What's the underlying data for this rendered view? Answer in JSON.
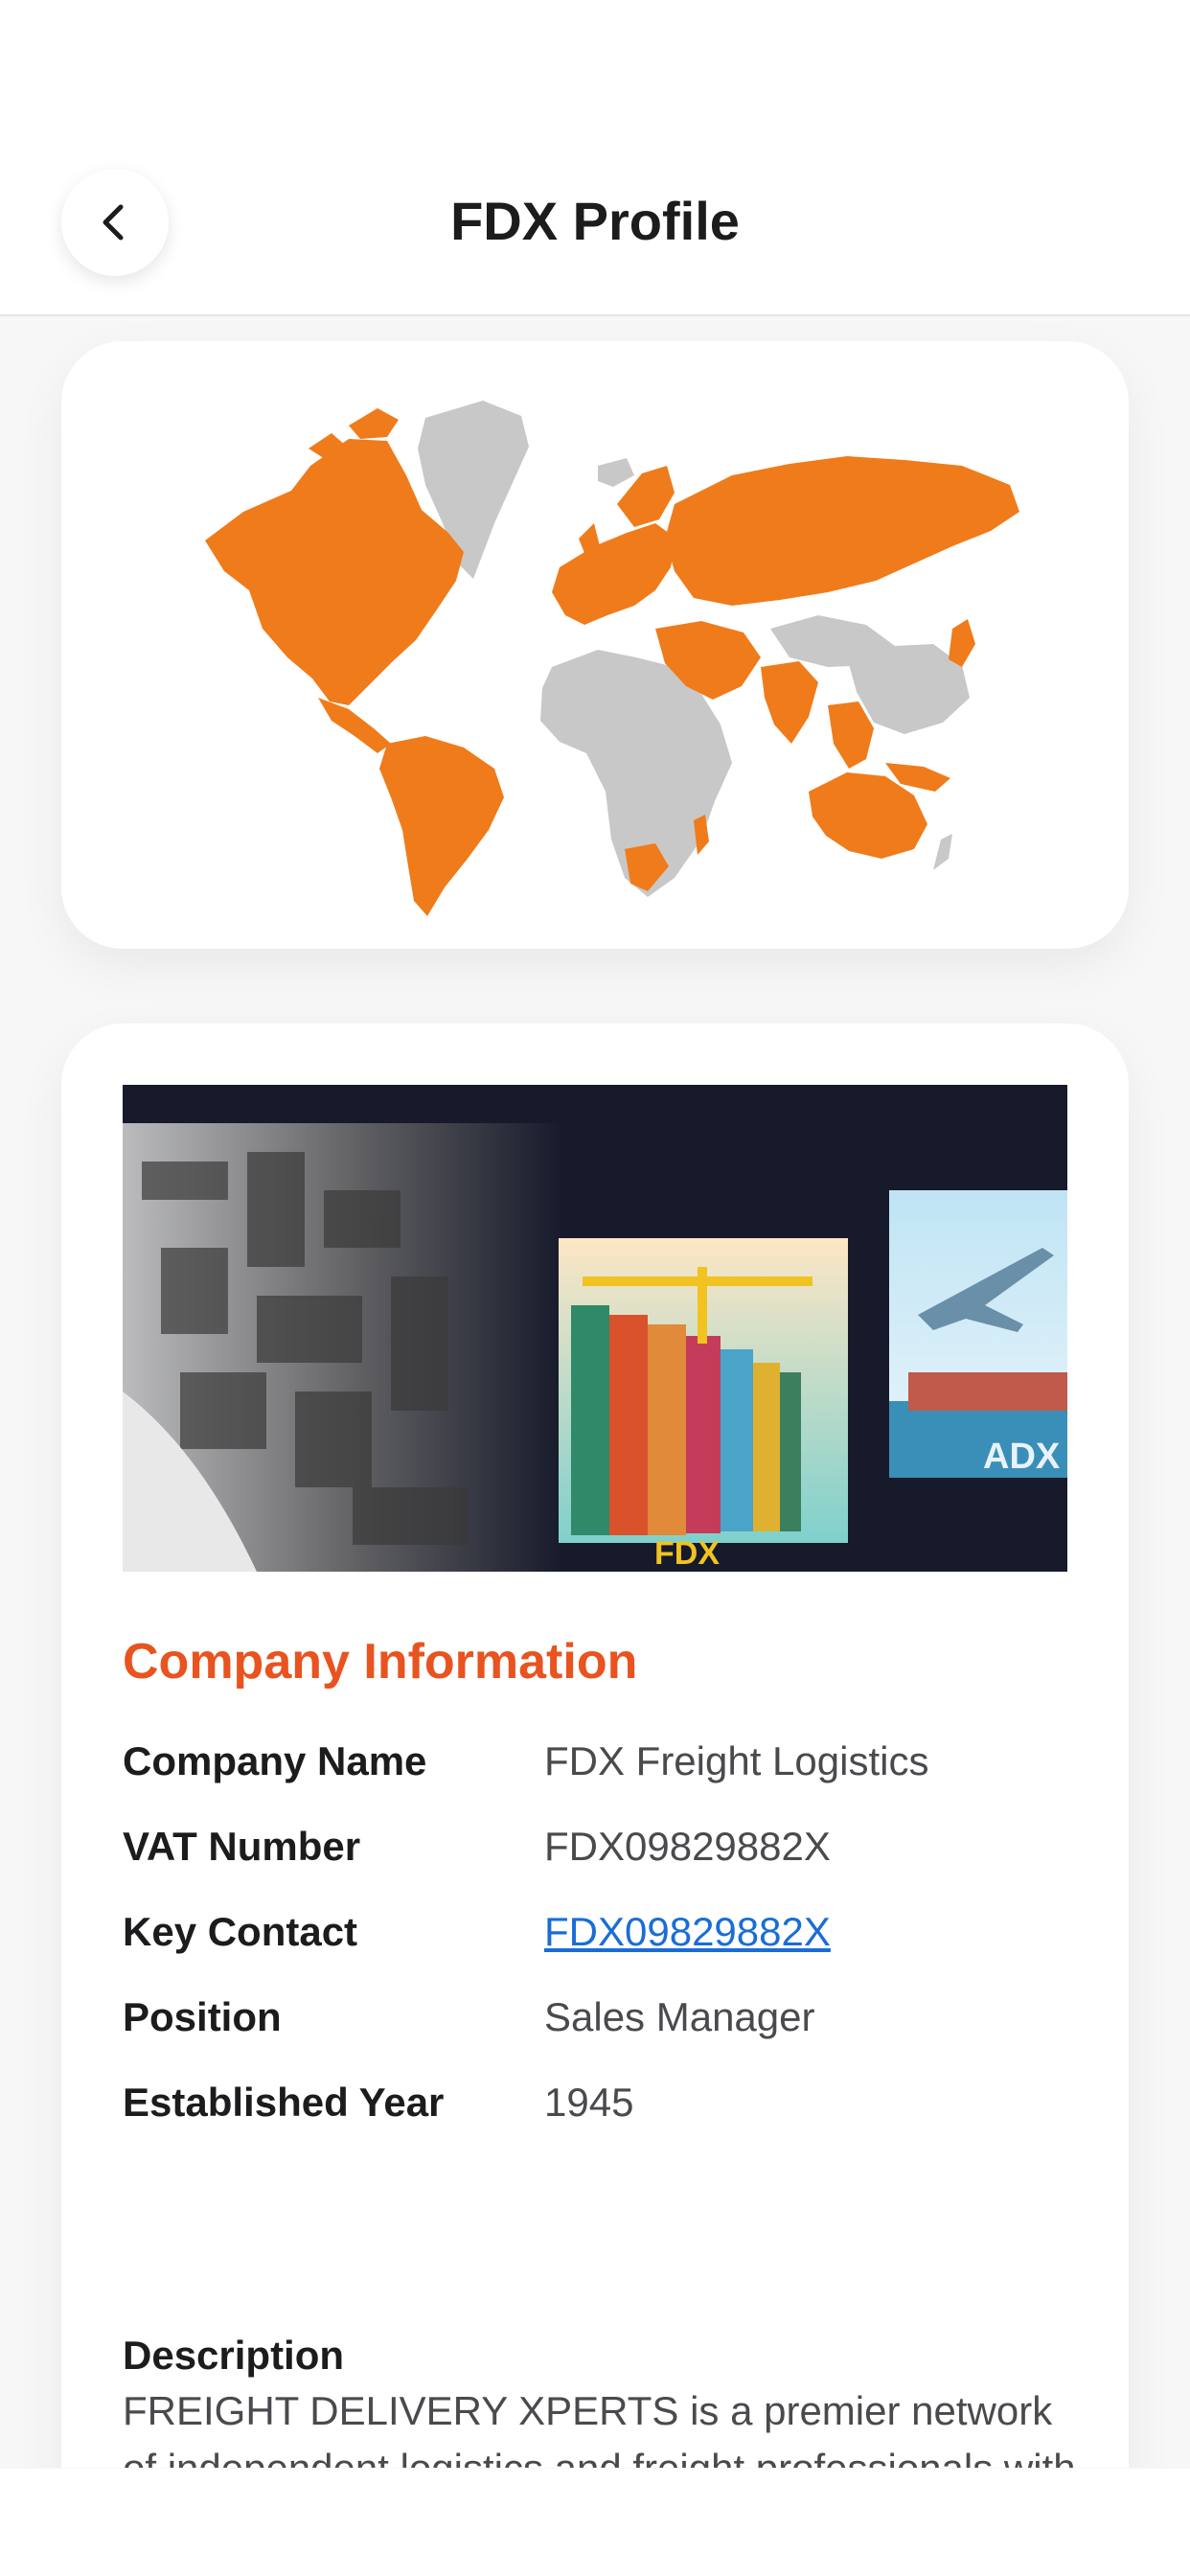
{
  "header": {
    "title": "FDX Profile",
    "back_icon": "chevron-left-icon"
  },
  "map": {
    "highlight_color": "#f07b1a",
    "base_color": "#c8c8c8"
  },
  "banner": {
    "left_logo": "FDX",
    "right_logo": "ADX"
  },
  "company_info": {
    "title": "Company Information",
    "rows": [
      {
        "label": "Company Name",
        "value": "FDX Freight Logistics"
      },
      {
        "label": "VAT Number",
        "value": "FDX09829882X"
      },
      {
        "label": "Key Contact",
        "value": "FDX09829882X"
      },
      {
        "label": "Position",
        "value": "Sales Manager"
      },
      {
        "label": "Established Year",
        "value": "1945"
      }
    ]
  },
  "description": {
    "label": "Description",
    "text": "FREIGHT DELIVERY XPERTS is a premier network of independent logistics and freight professionals with one main principle: Networking."
  },
  "colors": {
    "accent": "#e8531f",
    "link": "#1a6dd6"
  }
}
